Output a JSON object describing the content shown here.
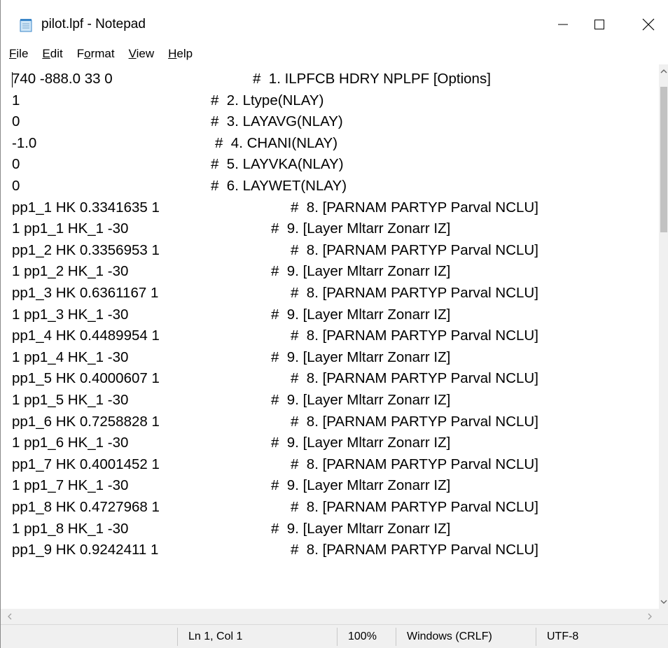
{
  "window": {
    "title": "pilot.lpf - Notepad"
  },
  "menu": {
    "file": {
      "key": "F",
      "rest": "ile"
    },
    "edit": {
      "key": "E",
      "rest": "dit"
    },
    "format": {
      "pre": "F",
      "key": "o",
      "rest": "rmat"
    },
    "view": {
      "key": "V",
      "rest": "iew"
    },
    "help": {
      "key": "H",
      "rest": "elp"
    }
  },
  "editor": {
    "lines": [
      {
        "text": "740 -888.0 33 0",
        "comment": "#  1. ILPFCB HDRY NPLPF [Options]"
      },
      {
        "text": "1",
        "comment": "#  2. Ltype(NLAY)"
      },
      {
        "text": "0",
        "comment": "#  3. LAYAVG(NLAY)"
      },
      {
        "text": "-1.0",
        "comment": "#  4. CHANI(NLAY)"
      },
      {
        "text": "0",
        "comment": "#  5. LAYVKA(NLAY)"
      },
      {
        "text": "0",
        "comment": "#  6. LAYWET(NLAY)"
      },
      {
        "text": "pp1_1 HK 0.3341635 1",
        "comment": "#  8. [PARNAM PARTYP Parval NCLU]"
      },
      {
        "text": "1 pp1_1 HK_1 -30",
        "comment": "#  9. [Layer Mltarr Zonarr IZ]"
      },
      {
        "text": "pp1_2 HK 0.3356953 1",
        "comment": "#  8. [PARNAM PARTYP Parval NCLU]"
      },
      {
        "text": "1 pp1_2 HK_1 -30",
        "comment": "#  9. [Layer Mltarr Zonarr IZ]"
      },
      {
        "text": "pp1_3 HK 0.6361167 1",
        "comment": "#  8. [PARNAM PARTYP Parval NCLU]"
      },
      {
        "text": "1 pp1_3 HK_1 -30",
        "comment": "#  9. [Layer Mltarr Zonarr IZ]"
      },
      {
        "text": "pp1_4 HK 0.4489954 1",
        "comment": "#  8. [PARNAM PARTYP Parval NCLU]"
      },
      {
        "text": "1 pp1_4 HK_1 -30",
        "comment": "#  9. [Layer Mltarr Zonarr IZ]"
      },
      {
        "text": "pp1_5 HK 0.4000607 1",
        "comment": "#  8. [PARNAM PARTYP Parval NCLU]"
      },
      {
        "text": "1 pp1_5 HK_1 -30",
        "comment": "#  9. [Layer Mltarr Zonarr IZ]"
      },
      {
        "text": "pp1_6 HK 0.7258828 1",
        "comment": "#  8. [PARNAM PARTYP Parval NCLU]"
      },
      {
        "text": "1 pp1_6 HK_1 -30",
        "comment": "#  9. [Layer Mltarr Zonarr IZ]"
      },
      {
        "text": "pp1_7 HK 0.4001452 1",
        "comment": "#  8. [PARNAM PARTYP Parval NCLU]"
      },
      {
        "text": "1 pp1_7 HK_1 -30",
        "comment": "#  9. [Layer Mltarr Zonarr IZ]"
      },
      {
        "text": "pp1_8 HK 0.4727968 1",
        "comment": "#  8. [PARNAM PARTYP Parval NCLU]"
      },
      {
        "text": "1 pp1_8 HK_1 -30",
        "comment": "#  9. [Layer Mltarr Zonarr IZ]"
      },
      {
        "text": "pp1_9 HK 0.9242411 1",
        "comment": "#  8. [PARNAM PARTYP Parval NCLU]"
      }
    ]
  },
  "statusbar": {
    "position": "Ln 1, Col 1",
    "zoom": "100%",
    "line_ending": "Windows (CRLF)",
    "encoding": "UTF-8"
  }
}
